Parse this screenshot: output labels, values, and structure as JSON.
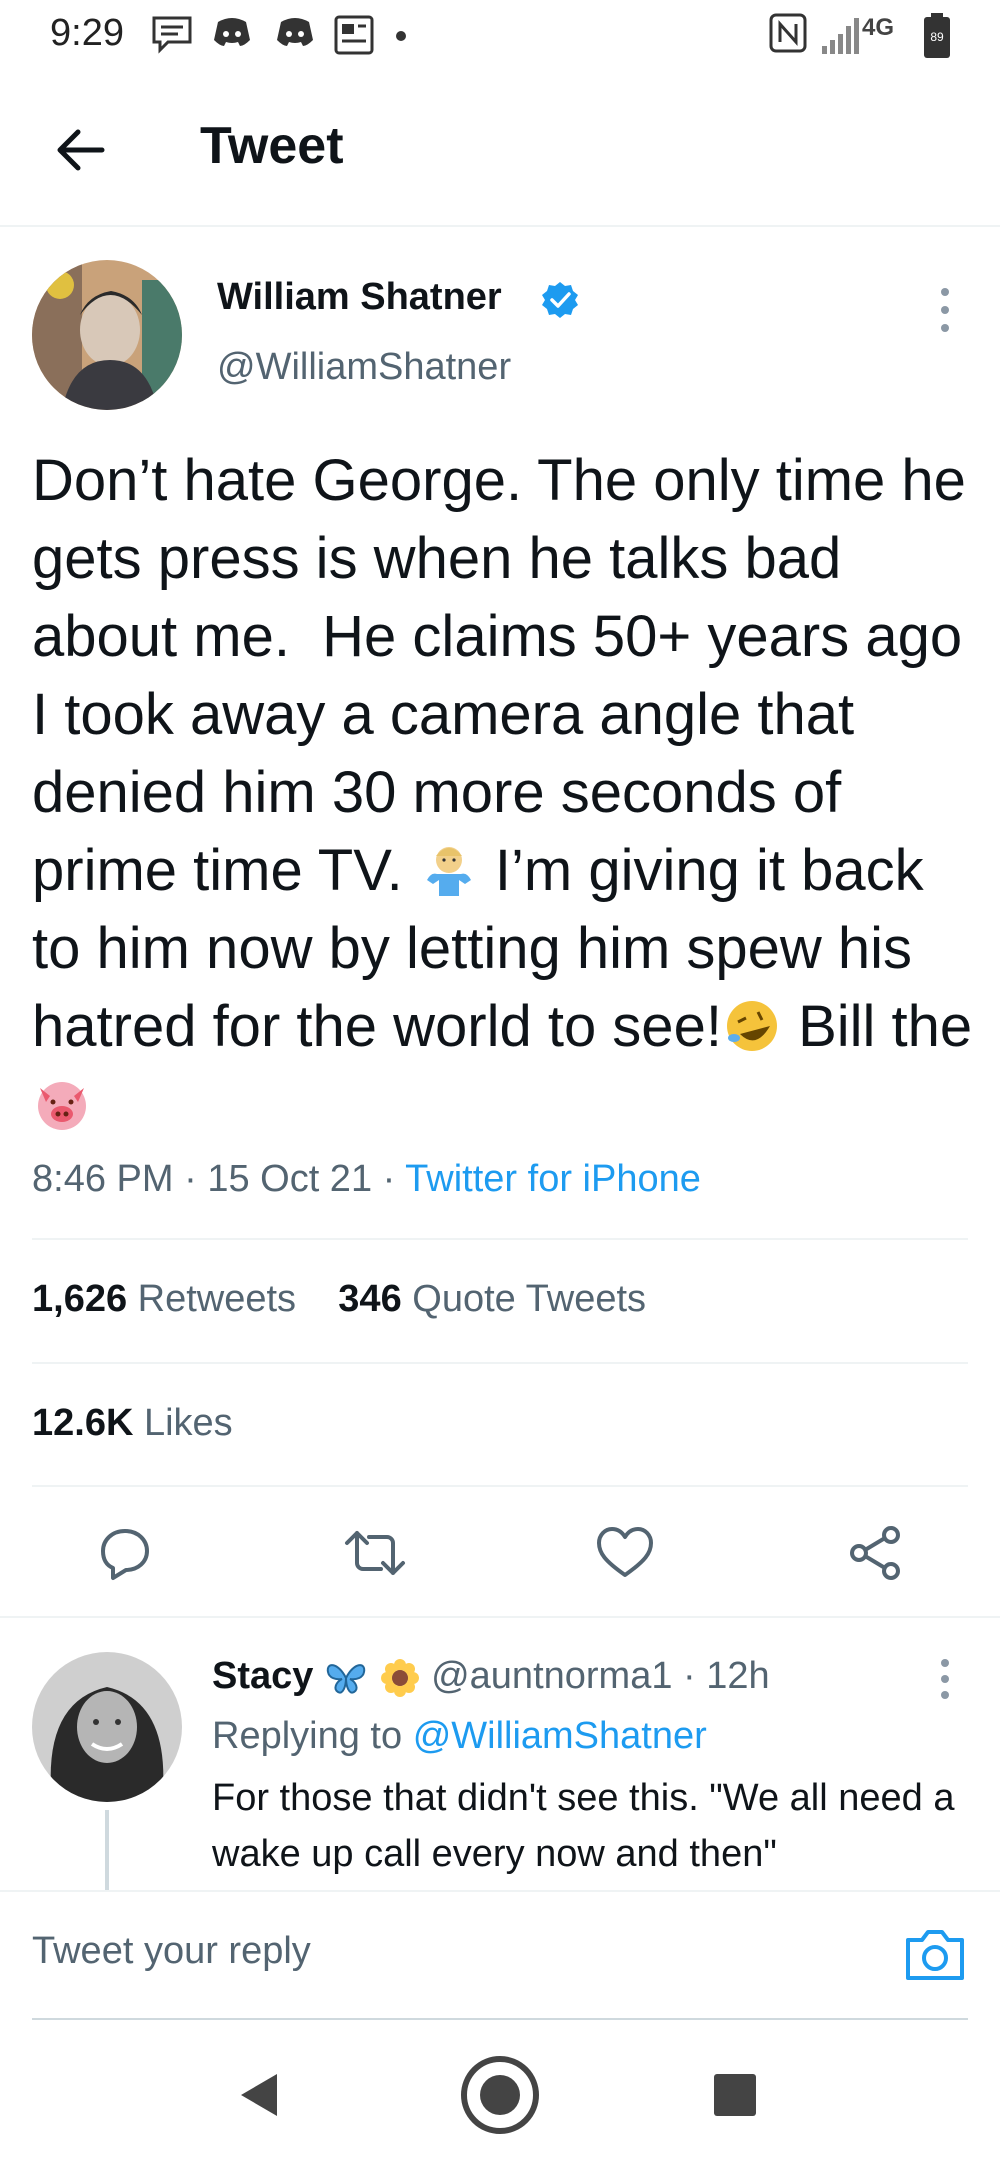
{
  "status_bar": {
    "time": "9:29",
    "network": "4G",
    "battery": "89",
    "icons": [
      "message-icon",
      "discord-icon",
      "discord-icon",
      "news-icon",
      "dot-icon",
      "nfc-icon",
      "signal-icon",
      "battery-icon"
    ]
  },
  "header": {
    "title": "Tweet"
  },
  "tweet": {
    "author_name": "William Shatner",
    "author_handle": "@WilliamShatner",
    "text_part1": "Don’t hate George. The only time he gets press is when he talks bad about me.  He claims 50+ years ago I took away a camera angle that denied him 30 more seconds of prime time TV. ",
    "text_part2": " I’m giving it back to him now by letting him spew his hatred for the world to see!",
    "text_part3": " Bill the ",
    "emojis": [
      "person-shrugging-emoji",
      "rolling-on-floor-laughing-emoji",
      "pig-face-emoji"
    ],
    "time": "8:46 PM",
    "date": "15 Oct 21",
    "source": "Twitter for iPhone",
    "retweets_count": "1,626",
    "retweets_label": "Retweets",
    "quotes_count": "346",
    "quotes_label": "Quote Tweets",
    "likes_count": "12.6K",
    "likes_label": "Likes",
    "accent_color": "#1d9bf0"
  },
  "reply": {
    "name": "Stacy",
    "name_emojis": [
      "butterfly-emoji",
      "sunflower-emoji"
    ],
    "handle": "@auntnorma1",
    "age": "12h",
    "replying_to_label": "Replying to",
    "replying_to_handle": "@WilliamShatner",
    "text": "For those that didn't see this. \"We all need a wake up call every now and then\""
  },
  "composer": {
    "placeholder": "Tweet your reply"
  }
}
